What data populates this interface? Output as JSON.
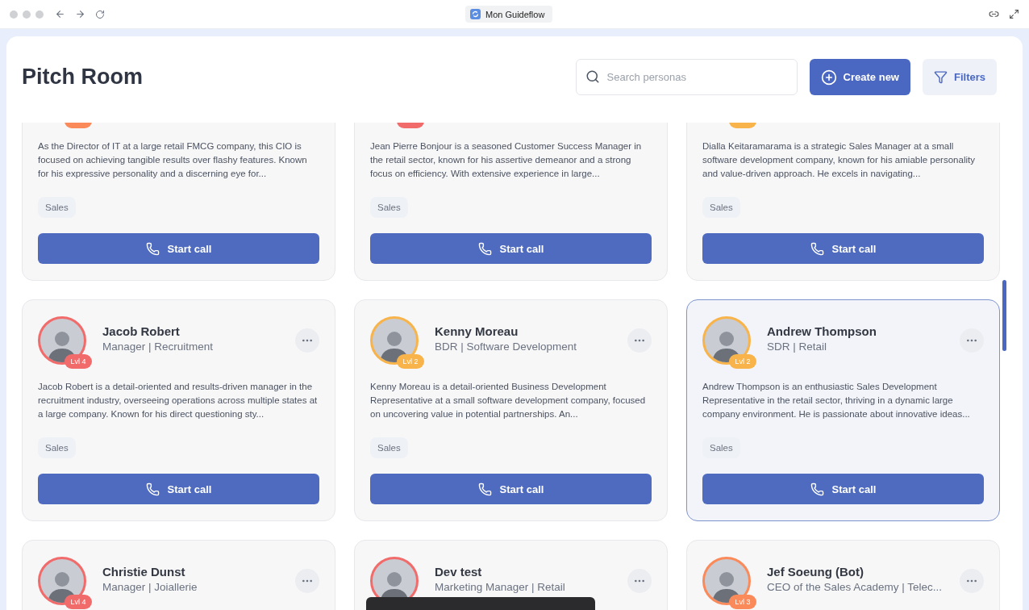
{
  "browser": {
    "tab_title": "Mon Guideflow"
  },
  "page": {
    "title": "Pitch Room",
    "search": {
      "placeholder": "Search personas"
    },
    "actions": [
      {
        "label": "Create new",
        "kind": "primary"
      },
      {
        "label": "Filters",
        "kind": "secondary"
      }
    ]
  },
  "personas": [
    {
      "kind": "partial",
      "color": "#fb8a5a",
      "selected": false,
      "description": "As the Director of IT at a large retail FMCG company, this CIO is focused on achieving tangible results over flashy features. Known for his expressive personality and a discerning eye for...",
      "tag": "Sales",
      "button": "Start call"
    },
    {
      "kind": "partial",
      "color": "#f26b6b",
      "selected": false,
      "description": "Jean Pierre Bonjour is a seasoned Customer Success Manager in the retail sector, known for his assertive demeanor and a strong focus on efficiency. With extensive experience in large...",
      "tag": "Sales",
      "button": "Start call"
    },
    {
      "kind": "partial",
      "color": "#f8b44a",
      "selected": false,
      "description": "Dialla Keitaramarama is a strategic Sales Manager at a small software development company, known for his amiable personality and value-driven approach. He excels in navigating...",
      "tag": "Sales",
      "button": "Start call"
    },
    {
      "kind": "full",
      "color": "#f26b6b",
      "selected": false,
      "name": "Jacob Robert",
      "role": "Manager | Recruitment",
      "badge": "Lvl 4",
      "description": "Jacob Robert is a detail-oriented and results-driven manager in the recruitment industry, overseeing operations across multiple states at a large company. Known for his direct questioning sty...",
      "tag": "Sales",
      "button": "Start call"
    },
    {
      "kind": "full",
      "color": "#f8b44a",
      "selected": false,
      "name": "Kenny Moreau",
      "role": "BDR | Software Development",
      "badge": "Lvl 2",
      "description": "Kenny Moreau is a detail-oriented Business Development Representative at a small software development company, focused on uncovering value in potential partnerships. An...",
      "tag": "Sales",
      "button": "Start call"
    },
    {
      "kind": "full",
      "color": "#f8b44a",
      "selected": true,
      "name": "Andrew Thompson",
      "role": "SDR | Retail",
      "badge": "Lvl 2",
      "description": "Andrew Thompson is an enthusiastic Sales Development Representative in the retail sector, thriving in a dynamic large company environment. He is passionate about innovative ideas...",
      "tag": "Sales",
      "button": "Start call"
    },
    {
      "kind": "full",
      "color": "#f26b6b",
      "selected": false,
      "name": "Christie Dunst",
      "role": "Manager | Joiallerie",
      "badge": "Lvl 4"
    },
    {
      "kind": "full",
      "color": "#f26b6b",
      "selected": false,
      "name": "Dev test",
      "role": "Marketing Manager | Retail"
    },
    {
      "kind": "full",
      "color": "#fb8a5a",
      "selected": false,
      "name": "Jef Soeung (Bot)",
      "role": "CEO of the Sales Academy | Telec...",
      "badge": "Lvl 3"
    }
  ],
  "toast": {
    "visible": true
  }
}
